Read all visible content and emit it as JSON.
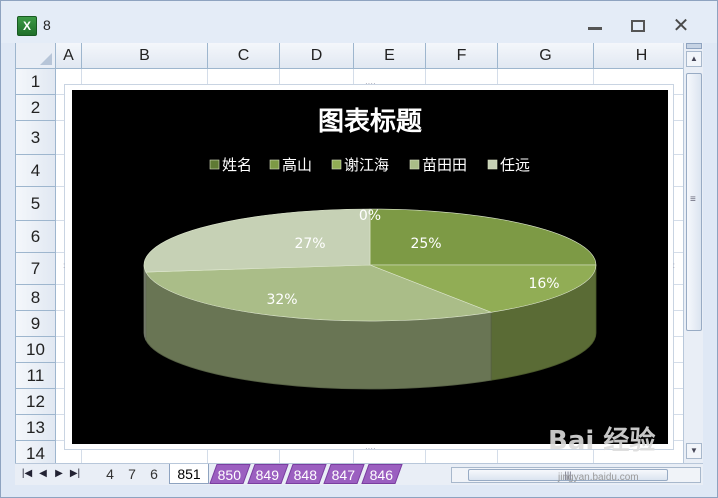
{
  "window": {
    "title": "8",
    "app_icon_letter": "X",
    "controls": {
      "minimize_icon": "minimize-icon",
      "maximize_icon": "maximize-icon",
      "close_label": "✕"
    }
  },
  "columns": [
    "A",
    "B",
    "C",
    "D",
    "E",
    "F",
    "G",
    "H"
  ],
  "rows": [
    "1",
    "2",
    "3",
    "4",
    "5",
    "6",
    "7",
    "8",
    "9",
    "10",
    "11",
    "12",
    "13",
    "14"
  ],
  "sheet_tabs": {
    "nav": [
      "|◀",
      "◀",
      "▶",
      "▶|"
    ],
    "plain": [
      "4",
      "7",
      "6"
    ],
    "active": "851",
    "purple": [
      "850",
      "849",
      "848",
      "847",
      "846"
    ]
  },
  "chart_data": {
    "type": "pie",
    "title": "图表标题",
    "legend_position": "top",
    "categories": [
      "姓名",
      "高山",
      "谢江海",
      "苗田田",
      "任远"
    ],
    "values": [
      0,
      25,
      16,
      32,
      27
    ],
    "data_labels": [
      "0%",
      "25%",
      "16%",
      "32%",
      "27%"
    ],
    "colors": [
      "#5f7a34",
      "#7d9a45",
      "#91ad55",
      "#aabd88",
      "#c6d1b5"
    ],
    "background": "#000000",
    "style": "3d-pie"
  },
  "watermark": {
    "text": "Bai 经验",
    "subtext": "jingyan.baidu.com"
  }
}
